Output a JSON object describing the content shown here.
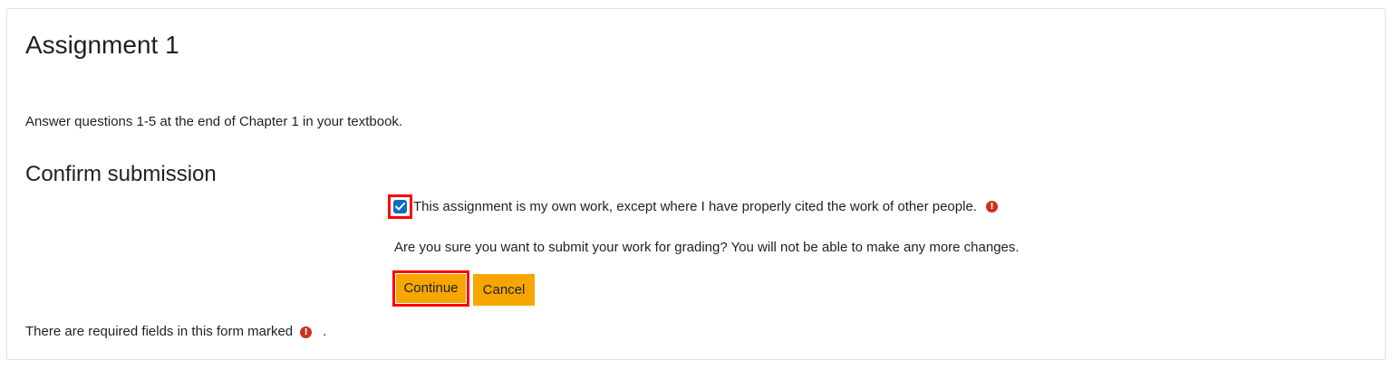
{
  "page": {
    "title": "Assignment 1",
    "intro": "Answer questions 1-5 at the end of Chapter 1 in your textbook."
  },
  "confirm": {
    "section_title": "Confirm submission",
    "statement_label": "This assignment is my own work, except where I have properly cited the work of other people.",
    "statement_checked": true,
    "question": "Are you sure you want to submit your work for grading? You will not be able to make any more changes.",
    "continue_label": "Continue",
    "cancel_label": "Cancel"
  },
  "footer": {
    "required_note": "There are required fields in this form marked",
    "required_note_end": "."
  },
  "icons": {
    "required": "exclamation-circle-icon",
    "checkbox": "check-icon"
  },
  "colors": {
    "button": "#f7a600",
    "checkbox": "#0f6cbf",
    "required": "#ca3120",
    "highlight": "#ff0000"
  }
}
